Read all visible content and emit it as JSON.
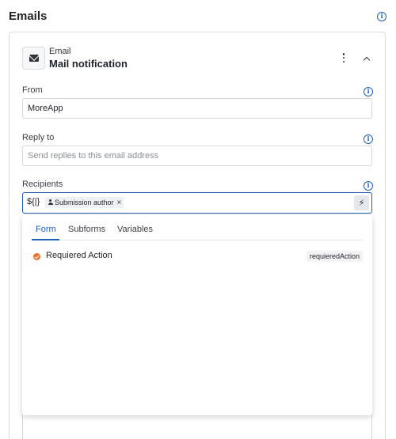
{
  "page": {
    "title": "Emails"
  },
  "email": {
    "type_label": "Email",
    "name": "Mail notification"
  },
  "fields": {
    "from": {
      "label": "From",
      "value": "MoreApp"
    },
    "reply_to": {
      "label": "Reply to",
      "placeholder": "Send replies to this email address"
    },
    "recipients": {
      "label": "Recipients",
      "variable_symbol": "${|}",
      "chip_label": "Submission author",
      "chip_remove": "×",
      "bolt_glyph": "⚡"
    }
  },
  "popup": {
    "tabs": [
      {
        "label": "Form",
        "active": true
      },
      {
        "label": "Subforms",
        "active": false
      },
      {
        "label": "Variables",
        "active": false
      }
    ],
    "items": [
      {
        "label": "Requiered Action",
        "tag": "requieredAction"
      }
    ]
  },
  "icons": {
    "info": "info-icon",
    "envelope": "envelope-icon",
    "kebab": "more-vertical-icon",
    "chevron": "chevron-up-icon",
    "person": "person-icon",
    "bolt": "bolt-icon",
    "check": "check-circle-icon"
  },
  "colors": {
    "accent": "#1e5fb8",
    "check": "#e8732a",
    "border": "#d4d7dc"
  }
}
